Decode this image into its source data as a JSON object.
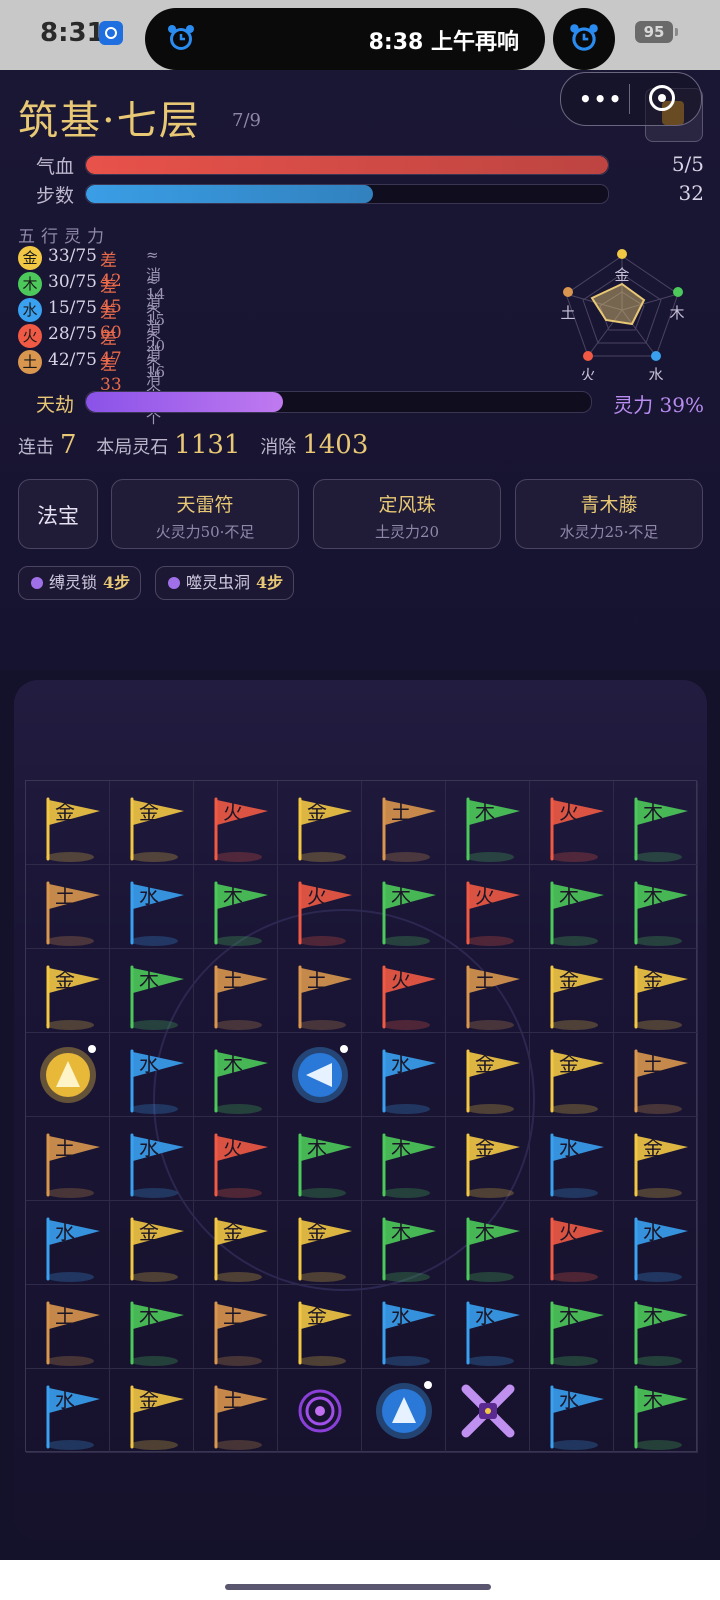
{
  "status_bar": {
    "time": "8:31",
    "alarm_text": "8:38 上午再响",
    "battery": "95"
  },
  "header": {
    "title": "筑基·七层",
    "progress": "7/9",
    "menu_dots": "•••"
  },
  "bars": {
    "hp": {
      "label": "气血",
      "value": "5/5",
      "fraction": 1.0,
      "color": "#e8524a"
    },
    "steps": {
      "label": "步数",
      "value": "32",
      "fraction": 0.55,
      "color": "#3a9ee6"
    }
  },
  "wuxing": {
    "title": "五行灵力",
    "rows": [
      {
        "element": "金",
        "current": "33/75",
        "diff": "差42",
        "estimate": "≈消14个",
        "color": "#f2c744"
      },
      {
        "element": "木",
        "current": "30/75",
        "diff": "差45",
        "estimate": "≈消15个",
        "color": "#4cc95a"
      },
      {
        "element": "水",
        "current": "15/75",
        "diff": "差60",
        "estimate": "≈消20个",
        "color": "#3aa0f0"
      },
      {
        "element": "火",
        "current": "28/75",
        "diff": "差47",
        "estimate": "≈消16个",
        "color": "#f05a44"
      },
      {
        "element": "土",
        "current": "42/75",
        "diff": "差33",
        "estimate": "≈消11个",
        "color": "#d8964e"
      }
    ],
    "radar_labels": [
      "金",
      "木",
      "水",
      "火",
      "土"
    ]
  },
  "tribulation": {
    "label": "天劫",
    "value": "灵力 39%",
    "fraction": 0.39
  },
  "stats": {
    "combo_label": "连击",
    "combo": "7",
    "stones_label": "本局灵石",
    "stones": "1131",
    "cleared_label": "消除",
    "cleared": "1403"
  },
  "skills": {
    "fabao_label": "法宝",
    "items": [
      {
        "name": "天雷符",
        "cost": "火灵力50·不足"
      },
      {
        "name": "定风珠",
        "cost": "土灵力20"
      },
      {
        "name": "青木藤",
        "cost": "水灵力25·不足"
      }
    ]
  },
  "effects": [
    {
      "name": "缚灵锁",
      "steps": "4步"
    },
    {
      "name": "噬灵虫洞",
      "steps": "4步"
    }
  ],
  "colors": {
    "金": "#f2c744",
    "木": "#4cc95a",
    "水": "#3aa0f0",
    "火": "#f05a44",
    "土": "#d8964e"
  },
  "board": [
    [
      "金",
      "金",
      "火",
      "金",
      "土",
      "木",
      "火",
      "木"
    ],
    [
      "土",
      "水",
      "木",
      "火",
      "木",
      "火",
      "木",
      "木"
    ],
    [
      "金",
      "木",
      "土",
      "土",
      "火",
      "土",
      "金",
      "金"
    ],
    [
      "special:gold-up",
      "水",
      "木",
      "special:blue-left",
      "水",
      "金",
      "金",
      "土"
    ],
    [
      "土",
      "水",
      "火",
      "木",
      "木",
      "金",
      "水",
      "金"
    ],
    [
      "水",
      "金",
      "金",
      "金",
      "木",
      "木",
      "火",
      "水"
    ],
    [
      "土",
      "木",
      "土",
      "金",
      "水",
      "水",
      "木",
      "木"
    ],
    [
      "水",
      "金",
      "土",
      "special:vortex",
      "special:blue-up",
      "special:cross",
      "水",
      "木"
    ]
  ]
}
